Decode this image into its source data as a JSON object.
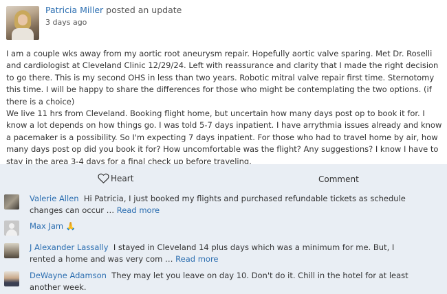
{
  "post": {
    "author": "Patricia Miller",
    "action": "posted an update",
    "time": "3 days ago",
    "body": "I am a couple wks away from my aortic root aneurysm repair. Hopefully aortic valve sparing. Met Dr. Roselli and cardiologist at Cleveland Clinic 12/29/24. Left with reassurance and clarity that I made the right decision to go there. This is my second OHS in less than two years. Robotic mitral valve repair first time. Sternotomy this time. I will be happy to share the differences for those who might be contemplating the two options. (if there is a choice)\nWe live 11 hrs from Cleveland. Booking flight home, but uncertain how many days post op to book it for. I know a lot depends on how things go. I was told 5-7 days inpatient. I have arrythmia issues already and know a pacemaker is a possibility. So I'm expecting 7 days inpatient. For those who had to travel home by air, how many days post op did you book it for? How uncomfortable was the flight? Any suggestions? I know I have to stay in the area 3-4 days for a final check up before traveling."
  },
  "actions": {
    "heart_label": "Heart",
    "comment_label": "Comment"
  },
  "comments": [
    {
      "name": "Valerie Allen",
      "text": "Hi Patricia, I just booked my flights and purchased refundable tickets as schedule changes can occur … ",
      "read_more": "Read more"
    },
    {
      "name": "Max Jam",
      "text": "🙏",
      "read_more": ""
    },
    {
      "name": "J Alexander Lassally",
      "text": "I stayed in Cleveland 14 plus days which was a minimum for me. But, I rented a home and was very com … ",
      "read_more": "Read more"
    },
    {
      "name": "DeWayne Adamson",
      "text": "They may let you leave on day 10. Don't do it. Chill in the hotel for at least another week.",
      "read_more": ""
    }
  ],
  "colors": {
    "link": "#2a6db0",
    "reaction_bg": "#e9eef4"
  },
  "icons": {
    "heart": "heart-outline-icon"
  }
}
